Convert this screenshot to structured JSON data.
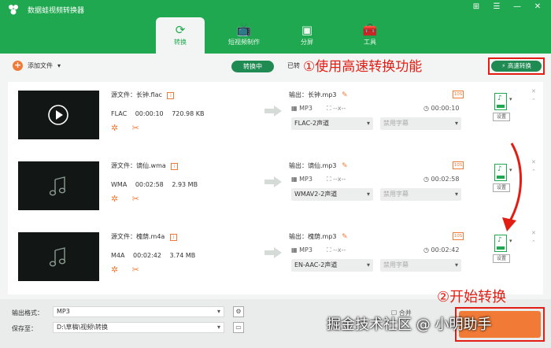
{
  "app": {
    "title": "数据蛙视频转换器"
  },
  "window_controls": [
    "⊞",
    "☰",
    "—",
    "✕"
  ],
  "nav": [
    {
      "label": "转换",
      "icon": "convert-icon",
      "glyph": "⟳"
    },
    {
      "label": "短视频制作",
      "icon": "tv-icon",
      "glyph": "📺"
    },
    {
      "label": "分屏",
      "icon": "split-screen-icon",
      "glyph": "▣"
    },
    {
      "label": "工具",
      "icon": "toolbox-icon",
      "glyph": "🧰"
    }
  ],
  "toolbar": {
    "add_file": "添加文件",
    "tab_converting": "转换中",
    "tab_done": "已转",
    "fast_convert": "高速转换"
  },
  "annotations": {
    "step1": "①使用高速转换功能",
    "step2": "②开始转换"
  },
  "files": [
    {
      "source": "源文件：长钟.flac",
      "format": "FLAC",
      "duration": "00:00:10",
      "size": "720.98 KB",
      "output": "输出：长钟.mp3",
      "out_format": "MP3",
      "resolution": "--x--",
      "out_duration": "00:00:10",
      "audio_track": "FLAC-2声道",
      "subtitle": "禁用字幕",
      "settings": "设置",
      "thumb": "play"
    },
    {
      "source": "源文件：谪仙.wma",
      "format": "WMA",
      "duration": "00:02:58",
      "size": "2.93 MB",
      "output": "输出：谪仙.mp3",
      "out_format": "MP3",
      "resolution": "--x--",
      "out_duration": "00:02:58",
      "audio_track": "WMAV2-2声道",
      "subtitle": "禁用字幕",
      "settings": "设置",
      "thumb": "music"
    },
    {
      "source": "源文件：槐荫.m4a",
      "format": "M4A",
      "duration": "00:02:42",
      "size": "3.74 MB",
      "output": "输出：槐荫.mp3",
      "out_format": "MP3",
      "resolution": "--x--",
      "out_duration": "00:02:42",
      "audio_track": "EN-AAC-2声道",
      "subtitle": "禁用字幕",
      "settings": "设置",
      "thumb": "music"
    }
  ],
  "bottom": {
    "output_format_label": "输出格式：",
    "output_format_value": "MP3",
    "save_to_label": "保存至：",
    "save_to_value": "D:\\草稿\\视频\\转换",
    "merge_label": "合并",
    "watermark": "掘金技术社区 @ 小明助手"
  },
  "colors": {
    "brand": "#1fa84f",
    "accent": "#f07a36",
    "annotation": "#e21d14"
  }
}
